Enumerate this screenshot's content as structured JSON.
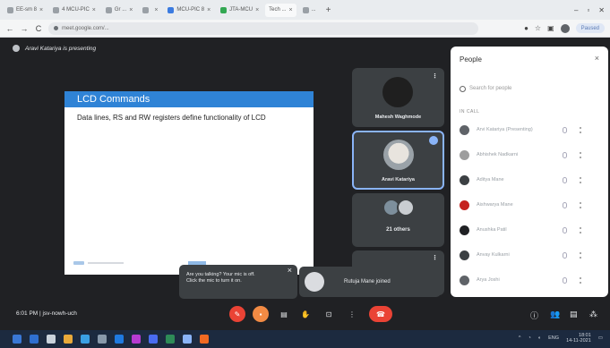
{
  "browser": {
    "tabs": [
      {
        "label": "EE-sm 8",
        "active": false
      },
      {
        "label": "4 MCU-PIC",
        "active": false
      },
      {
        "label": "Gr ...",
        "active": false
      },
      {
        "label": "",
        "active": false
      },
      {
        "label": "MCU-PIC 8",
        "active": false
      },
      {
        "label": "JTA-MCU",
        "active": false
      },
      {
        "label": "Tech ...",
        "active": true
      },
      {
        "label": "...",
        "active": false
      }
    ],
    "new_tab": "+",
    "url": "meet.google.com/...",
    "paused_label": "Paused"
  },
  "meet": {
    "presenting_banner": "Aravi Katariya is presenting",
    "slide": {
      "title": "LCD Commands",
      "body": "Data lines, RS and RW registers define functionality of LCD"
    },
    "tiles": [
      {
        "name": "Mahesh Waghmode",
        "has_more": true
      },
      {
        "name": "Aravi Katariya",
        "speaking": true
      },
      {
        "name": "21 others"
      },
      {
        "name": "",
        "has_more": true
      }
    ],
    "mic_toast": {
      "line1": "Are you talking? Your mic is off.",
      "line2": "Click the mic to turn it on.",
      "close": "×"
    },
    "join_toast": "Rutuja Mane joined",
    "people_panel": {
      "title": "People",
      "close": "×",
      "search_placeholder": "Search for people",
      "section_label": "IN CALL",
      "participants": [
        {
          "name": "Arvi Katariya (Presenting)",
          "color": "#5f6368"
        },
        {
          "name": "Abhishek Nadkarni",
          "color": "#9e9e9e"
        },
        {
          "name": "Aditya Mane",
          "color": "#3c4043"
        },
        {
          "name": "Aishwarya Mane",
          "color": "#c5221f"
        },
        {
          "name": "Anushka Patil",
          "color": "#202124"
        },
        {
          "name": "Anvay Kulkarni",
          "color": "#3c4043"
        },
        {
          "name": "Arya Joshi",
          "color": "#5f6368"
        }
      ]
    },
    "bottom_bar": {
      "time": "6:01 PM",
      "separator": "|",
      "meeting_code": "jsv-nowh-uch"
    }
  },
  "taskbar": {
    "apps": [
      "#3a78d6",
      "#2f6fd0",
      "#c9d2dc",
      "#e8a93a",
      "#3aa0e3",
      "#8899aa",
      "#1f7ae0",
      "#b63bd1",
      "#4a6cf0",
      "#2e8b57",
      "#8ab4f8",
      "#f06a22"
    ],
    "tray_lang": "ENG",
    "clock_time": "18:01",
    "clock_date": "14-11-2021"
  }
}
